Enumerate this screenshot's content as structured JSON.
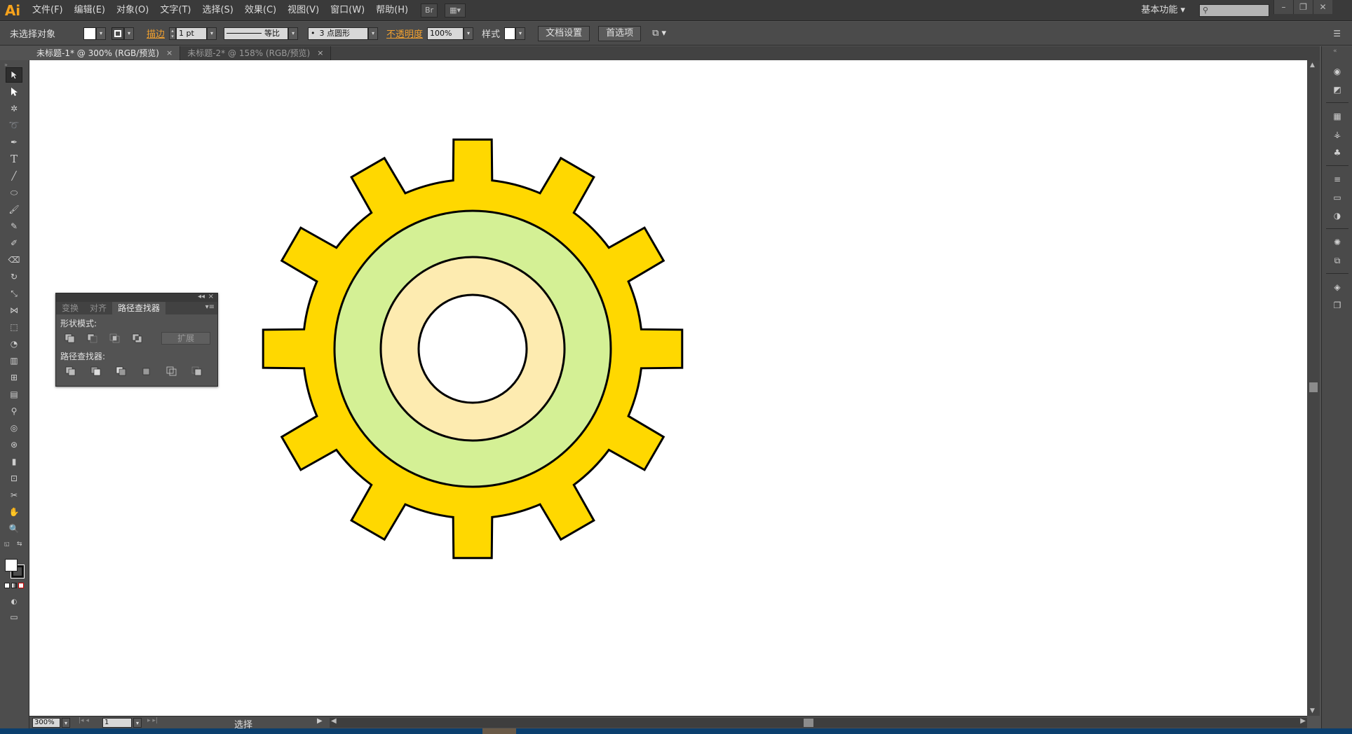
{
  "app": {
    "logo": "Ai"
  },
  "menu": [
    "文件(F)",
    "编辑(E)",
    "对象(O)",
    "文字(T)",
    "选择(S)",
    "效果(C)",
    "视图(V)",
    "窗口(W)",
    "帮助(H)"
  ],
  "workspace": "基本功能",
  "control_bar": {
    "selection_label": "未选择对象",
    "stroke_label": "描边",
    "stroke_weight": "1 pt",
    "stroke_profile": "等比",
    "brush": "3 点圆形",
    "opacity_label": "不透明度",
    "opacity_value": "100%",
    "style_label": "样式",
    "doc_setup": "文档设置",
    "preferences": "首选项"
  },
  "tabs": [
    {
      "label": "未标题-1* @ 300% (RGB/预览)",
      "active": true
    },
    {
      "label": "未标题-2* @ 158% (RGB/预览)",
      "active": false
    }
  ],
  "pathfinder_panel": {
    "tabs": [
      "变换",
      "对齐",
      "路径查找器"
    ],
    "shape_modes_label": "形状模式:",
    "expand_label": "扩展",
    "pathfinders_label": "路径查找器:"
  },
  "status": {
    "zoom": "300%",
    "page": "1",
    "tool_text": "选择"
  },
  "colors": {
    "gear": "#ffd800",
    "ring_green": "#d4f095",
    "ring_cream": "#fdebb0",
    "hole": "#ffffff",
    "outline": "#000000"
  }
}
